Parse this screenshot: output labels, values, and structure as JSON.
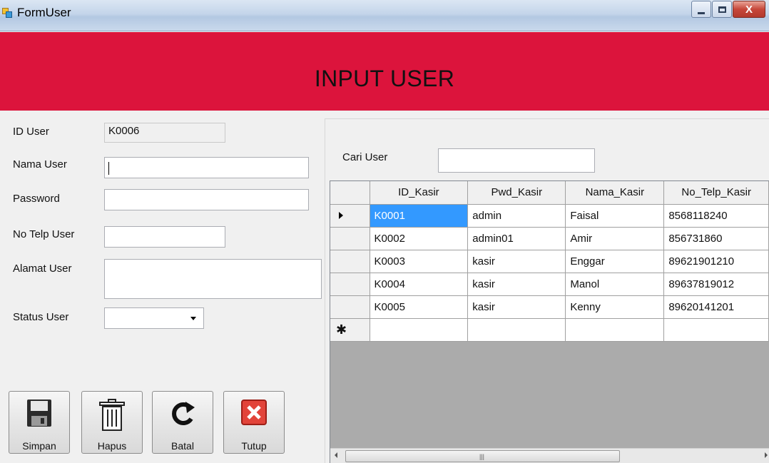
{
  "window": {
    "title": "FormUser",
    "close_glyph": "X"
  },
  "header": {
    "title": "INPUT USER"
  },
  "form": {
    "id_user_label": "ID User",
    "id_user_value": "K0006",
    "nama_user_label": "Nama User",
    "nama_user_value": "",
    "password_label": "Password",
    "password_value": "",
    "no_telp_label": "No Telp User",
    "no_telp_value": "",
    "alamat_label": "Alamat User",
    "alamat_value": "",
    "status_label": "Status User",
    "status_value": ""
  },
  "buttons": {
    "simpan": {
      "label": "Simpan",
      "icon": "floppy-disk-icon"
    },
    "hapus": {
      "label": "Hapus",
      "icon": "trash-icon"
    },
    "batal": {
      "label": "Batal",
      "icon": "refresh-icon"
    },
    "tutup": {
      "label": "Tutup",
      "icon": "close-icon"
    }
  },
  "search": {
    "label": "Cari User",
    "value": ""
  },
  "grid": {
    "columns": [
      "ID_Kasir",
      "Pwd_Kasir",
      "Nama_Kasir",
      "No_Telp_Kasir"
    ],
    "rows": [
      [
        "K0001",
        "admin",
        "Faisal",
        "8568118240"
      ],
      [
        "K0002",
        "admin01",
        "Amir",
        "856731860"
      ],
      [
        "K0003",
        "kasir",
        "Enggar",
        "89621901210"
      ],
      [
        "K0004",
        "kasir",
        "Manol",
        "89637819012"
      ],
      [
        "K0005",
        "kasir",
        "Kenny",
        "89620141201"
      ]
    ],
    "new_row_marker": "✱",
    "selected_row": 0
  },
  "colors": {
    "header_bg": "#dc143c",
    "selection": "#3399ff"
  }
}
